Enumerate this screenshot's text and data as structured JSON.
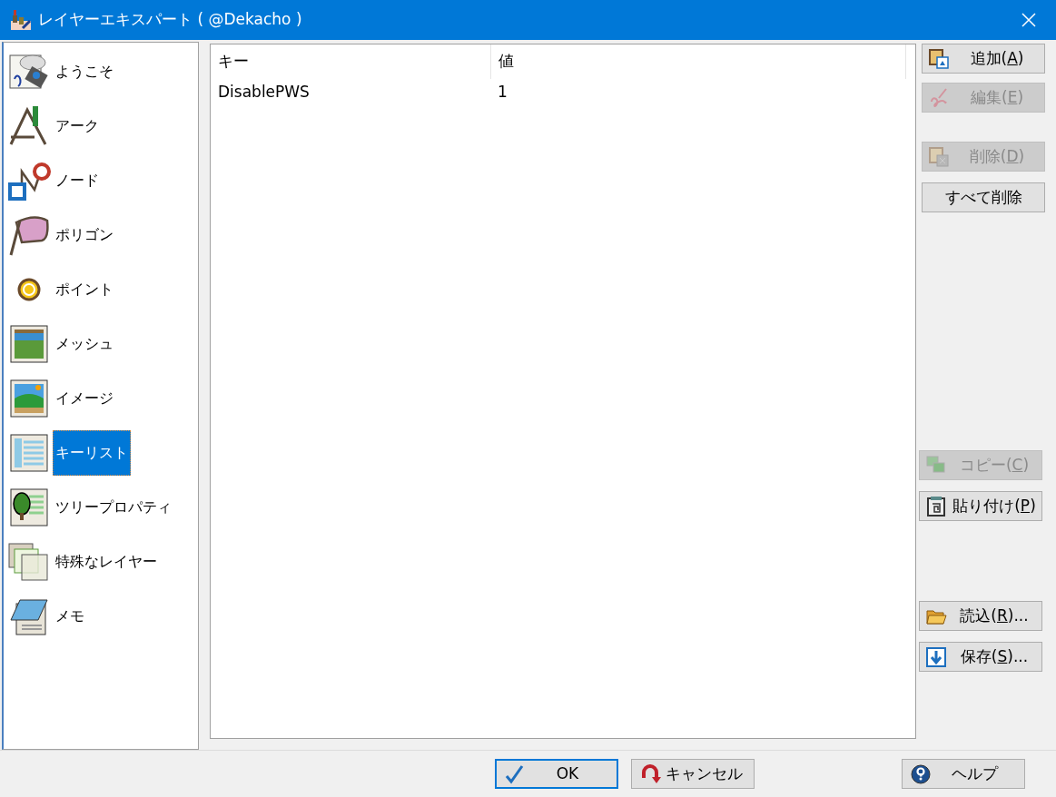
{
  "window": {
    "title": "レイヤーエキスパート ( @Dekacho )"
  },
  "sidebar": {
    "items": [
      {
        "label": "ようこそ",
        "selected": false
      },
      {
        "label": "アーク",
        "selected": false
      },
      {
        "label": "ノード",
        "selected": false
      },
      {
        "label": "ポリゴン",
        "selected": false
      },
      {
        "label": "ポイント",
        "selected": false
      },
      {
        "label": "メッシュ",
        "selected": false
      },
      {
        "label": "イメージ",
        "selected": false
      },
      {
        "label": "キーリスト",
        "selected": true
      },
      {
        "label": "ツリープロパティ",
        "selected": false
      },
      {
        "label": "特殊なレイヤー",
        "selected": false
      },
      {
        "label": "メモ",
        "selected": false
      }
    ]
  },
  "table": {
    "columns": [
      "キー",
      "値"
    ],
    "rows": [
      [
        "DisablePWS",
        "1"
      ]
    ]
  },
  "button_groups": [
    [
      {
        "before": "追加(",
        "key": "A",
        "after": ")",
        "disabled": false
      },
      {
        "before": "編集(",
        "key": "E",
        "after": ")",
        "disabled": true
      }
    ],
    [
      {
        "before": "削除(",
        "key": "D",
        "after": ")",
        "disabled": true
      },
      {
        "before": "すべて削除",
        "disabled": false
      }
    ],
    [
      {
        "before": "コピー(",
        "key": "C",
        "after": ")",
        "disabled": true
      },
      {
        "before": "貼り付け(",
        "key": "P",
        "after": ")",
        "disabled": false
      }
    ],
    [
      {
        "before": "読込(",
        "key": "R",
        "after": ")...",
        "disabled": false
      },
      {
        "before": "保存(",
        "key": "S",
        "after": ")...",
        "disabled": false
      }
    ]
  ],
  "footer_buttons": [
    {
      "label": "OK",
      "default": true
    },
    {
      "label": "キャンセル",
      "default": false
    },
    {
      "label": "ヘルプ",
      "default": false
    }
  ]
}
